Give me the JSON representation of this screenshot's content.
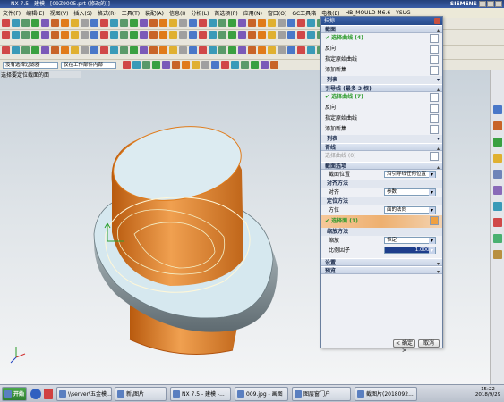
{
  "window": {
    "title": "NX 7.5 - 建模 - [09Z9005.prt (修改的)]",
    "brand": "SIEMENS"
  },
  "menu": [
    "文件(F)",
    "编辑(E)",
    "视图(V)",
    "插入(S)",
    "格式(R)",
    "工具(T)",
    "装配(A)",
    "信息(I)",
    "分析(L)",
    "首选项(P)",
    "应用(N)",
    "窗口(O)",
    "GC工具箱",
    "电极(E)",
    "HB_MOULD M6.6",
    "YSUG"
  ],
  "filter": {
    "type_value": "没有选择过滤器",
    "scope_value": "仅在工作部件内部"
  },
  "viewport": {
    "prompt": "选择要定位截面的面"
  },
  "dialog": {
    "title": "扫掠",
    "sections": {
      "section": {
        "title": "截面",
        "select_curve": "✔ 选择曲线 (4)",
        "reverse": "反向",
        "specify_origin": "指定原始曲线",
        "add_new": "添加新集",
        "list": "列表"
      },
      "guide": {
        "title": "引导线 (最多 3 根)",
        "select_curve": "✔ 选择曲线 (7)",
        "reverse": "反向",
        "specify_origin": "指定原始曲线",
        "add_new": "添加新集",
        "list": "列表"
      },
      "spine": {
        "title": "脊线",
        "select_curve": "选择曲线 (0)"
      },
      "options": {
        "title": "截面选项",
        "position_label": "截面位置",
        "position_value": "沿引导线任何位置",
        "align_title": "对齐方法",
        "align_label": "对齐",
        "align_value": "参数",
        "orient_title": "定位方法",
        "orient_label": "方位",
        "orient_value": "面的法向",
        "orient_select": "✔ 选择面 (1)",
        "scale_title": "缩放方法",
        "scale_label": "缩放",
        "scale_value": "恒定",
        "ratio_label": "比例因子",
        "ratio_value": "1.0000"
      },
      "settings": {
        "title": "设置"
      },
      "preview": {
        "title": "预览"
      }
    },
    "ok": "< 确定 >",
    "cancel": "取消"
  },
  "taskbar": {
    "start": "开始",
    "tasks": [
      "\\\\server\\五金模...",
      "新\\图片",
      "NX 7.5 - 建模 -...",
      "009.jpg - 画图",
      "图层窗门户",
      "截图片(2018092..."
    ],
    "time": "15:22",
    "date": "2018/9/29"
  },
  "colors": {
    "accent": "#2d56a0",
    "body": "#e07b1a",
    "surface": "#d4e6ee"
  }
}
